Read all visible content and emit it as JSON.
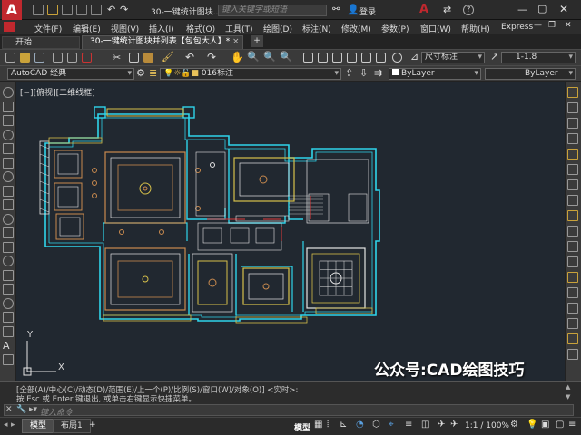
{
  "app": {
    "logo": "A",
    "quick_doc_title": "30-一键统计图块...",
    "search_placeholder": "键入关键字或短语",
    "login": "登录",
    "help": "?"
  },
  "menu": [
    "文件(F)",
    "编辑(E)",
    "视图(V)",
    "插入(I)",
    "格式(O)",
    "工具(T)",
    "绘图(D)",
    "标注(N)",
    "修改(M)",
    "参数(P)",
    "窗口(W)",
    "帮助(H)",
    "Express"
  ],
  "tabs": {
    "start": "开始",
    "active": "30-一键统计图块并列表【包包大人】*",
    "close": "×",
    "add": "+"
  },
  "ribbon": {
    "dim_style": "尺寸标注",
    "scale": "1-1.8"
  },
  "props": {
    "workspace": "AutoCAD 经典",
    "layer": "016标注",
    "color": "ByLayer",
    "linetype": "ByLayer"
  },
  "viewport_label": "[−][俯视][二维线框]",
  "axis": {
    "y": "Y",
    "x": "X"
  },
  "watermark": "公众号:CAD绘图技巧",
  "command": {
    "line1": "[全部(A)/中心(C)/动态(D)/范围(E)/上一个(P)/比例(S)/窗口(W)/对象(O)] <实时>:",
    "line2": "按 Esc 或 Enter 键退出, 或单击右键显示快捷菜单。",
    "placeholder": "键入命令"
  },
  "status": {
    "model_tab": "模型",
    "layout_tab": "布局1",
    "add": "+",
    "model_btn": "模型",
    "scale": "1:1 / 100%"
  },
  "colors": {
    "accent": "#c0282e",
    "cyan": "#2fd4ea",
    "yellow": "#d6c04a",
    "orange": "#c98a4e",
    "white": "#e5e5e5",
    "red": "#e03a3a"
  }
}
